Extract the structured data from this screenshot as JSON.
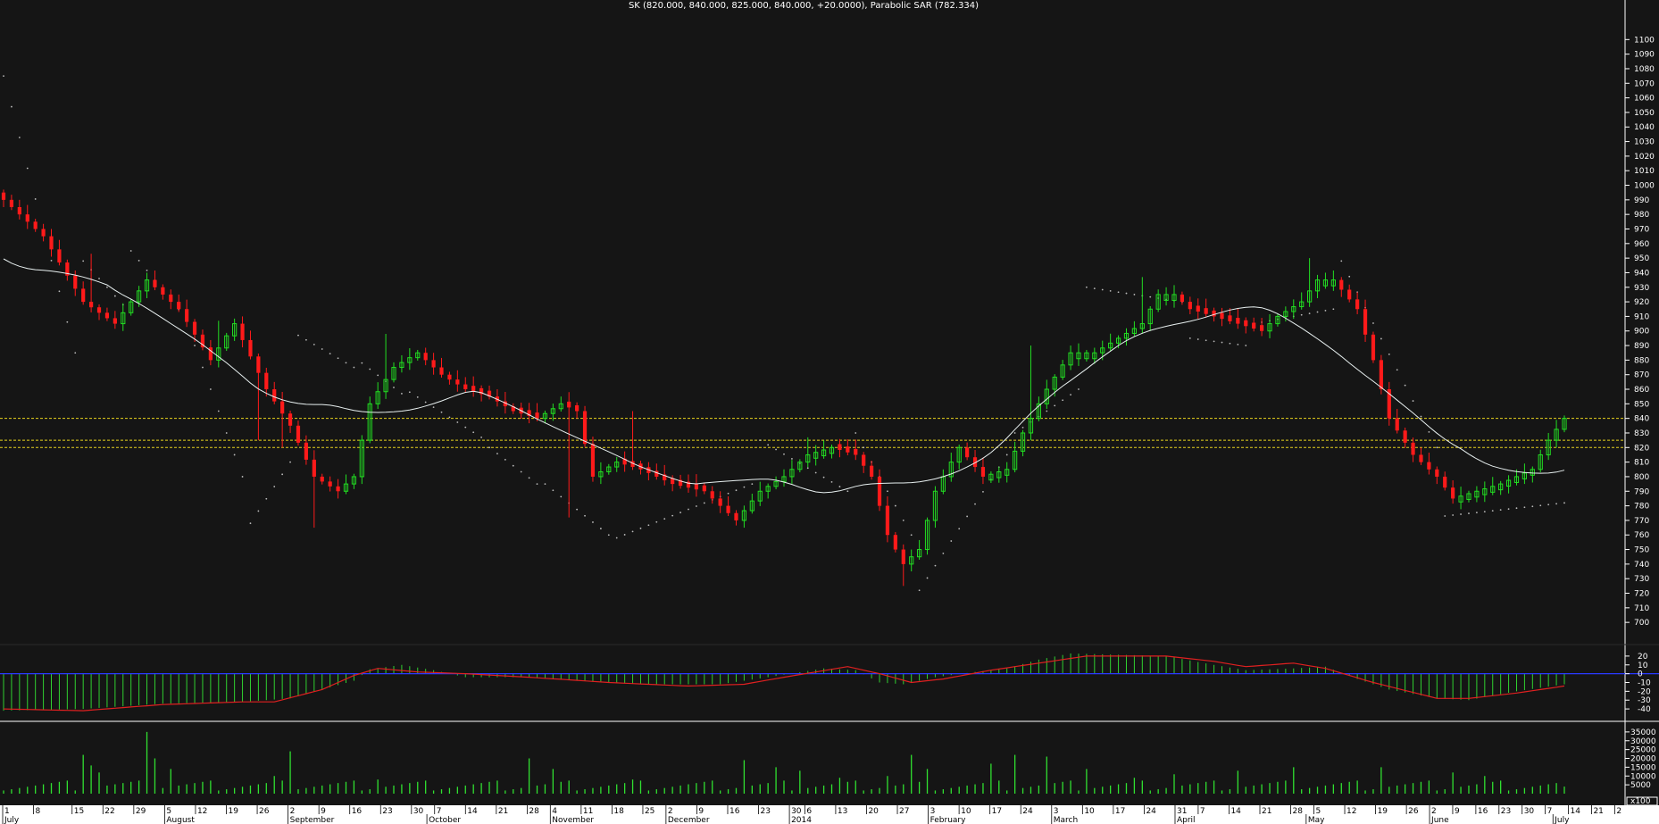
{
  "chart_data": {
    "type": "candlestick",
    "title": "SK (820.000, 840.000, 825.000, 840.000, +20.0000), Parabolic SAR (782.334)",
    "colors": {
      "background": "#151515",
      "up": "#22dd22",
      "down": "#ff1a1a",
      "ma_line": "#e8f0f0",
      "sar_dots": "#bbbbbb",
      "ref_lines": "#e6d21e",
      "macd_hist": "#30d030",
      "macd_signal": "#e02020",
      "macd_zero": "#2a3aff",
      "volume": "#30e030",
      "axis_bar": "#ffffff",
      "grid_text": "#ffffff"
    },
    "price_axis": {
      "ylim": [
        686,
        1110
      ],
      "ticks": [
        700,
        710,
        720,
        730,
        740,
        750,
        760,
        770,
        780,
        790,
        800,
        810,
        820,
        830,
        840,
        850,
        860,
        870,
        880,
        890,
        900,
        910,
        920,
        930,
        940,
        950,
        960,
        970,
        980,
        990,
        1000,
        1010,
        1020,
        1030,
        1040,
        1050,
        1060,
        1070,
        1080,
        1090,
        1100
      ]
    },
    "reference_lines": [
      840,
      825,
      820
    ],
    "price_keypoints": [
      [
        0,
        990
      ],
      [
        5,
        965
      ],
      [
        10,
        920
      ],
      [
        14,
        905
      ],
      [
        18,
        935
      ],
      [
        22,
        915
      ],
      [
        26,
        880
      ],
      [
        29,
        905
      ],
      [
        33,
        860
      ],
      [
        36,
        835
      ],
      [
        39,
        800
      ],
      [
        42,
        790
      ],
      [
        44,
        800
      ],
      [
        46,
        850
      ],
      [
        49,
        875
      ],
      [
        52,
        885
      ],
      [
        55,
        870
      ],
      [
        58,
        860
      ],
      [
        61,
        855
      ],
      [
        64,
        845
      ],
      [
        67,
        840
      ],
      [
        70,
        850
      ],
      [
        72,
        845
      ],
      [
        74,
        800
      ],
      [
        77,
        810
      ],
      [
        80,
        805
      ],
      [
        84,
        795
      ],
      [
        88,
        790
      ],
      [
        92,
        770
      ],
      [
        95,
        790
      ],
      [
        98,
        800
      ],
      [
        101,
        815
      ],
      [
        104,
        820
      ],
      [
        107,
        815
      ],
      [
        109,
        800
      ],
      [
        111,
        760
      ],
      [
        113,
        740
      ],
      [
        115,
        750
      ],
      [
        117,
        790
      ],
      [
        120,
        820
      ],
      [
        123,
        800
      ],
      [
        126,
        805
      ],
      [
        128,
        830
      ],
      [
        131,
        860
      ],
      [
        134,
        885
      ],
      [
        137,
        885
      ],
      [
        140,
        895
      ],
      [
        143,
        905
      ],
      [
        145,
        925
      ],
      [
        147,
        925
      ],
      [
        149,
        915
      ],
      [
        152,
        910
      ],
      [
        155,
        905
      ],
      [
        158,
        900
      ],
      [
        160,
        910
      ],
      [
        163,
        920
      ],
      [
        165,
        935
      ],
      [
        167,
        935
      ],
      [
        170,
        915
      ],
      [
        172,
        880
      ],
      [
        174,
        840
      ],
      [
        177,
        815
      ],
      [
        180,
        800
      ],
      [
        182,
        785
      ],
      [
        185,
        790
      ],
      [
        188,
        795
      ],
      [
        190,
        800
      ],
      [
        192,
        805
      ],
      [
        194,
        825
      ],
      [
        196,
        840
      ]
    ],
    "price_spikes": [
      [
        11,
        953,
        "high"
      ],
      [
        23,
        905,
        "high"
      ],
      [
        27,
        907,
        "high"
      ],
      [
        32,
        825,
        "low"
      ],
      [
        35,
        820,
        "low"
      ],
      [
        39,
        765,
        "low"
      ],
      [
        48,
        898,
        "high"
      ],
      [
        57,
        873,
        "high"
      ],
      [
        71,
        772,
        "low"
      ],
      [
        79,
        845,
        "high"
      ],
      [
        101,
        827,
        "high"
      ],
      [
        113,
        725,
        "low"
      ],
      [
        129,
        890,
        "high"
      ],
      [
        143,
        937,
        "high"
      ],
      [
        164,
        950,
        "high"
      ]
    ],
    "sar_segments": [
      {
        "from": 0,
        "to": 9,
        "start": 1075,
        "end": 885
      },
      {
        "from": 10,
        "to": 15,
        "start": 948,
        "end": 918
      },
      {
        "from": 16,
        "to": 23,
        "start": 955,
        "end": 908
      },
      {
        "from": 24,
        "to": 30,
        "start": 890,
        "end": 800
      },
      {
        "from": 31,
        "to": 36,
        "start": 768,
        "end": 810
      },
      {
        "from": 37,
        "to": 44,
        "start": 897,
        "end": 875
      },
      {
        "from": 45,
        "to": 50,
        "start": 878,
        "end": 857
      },
      {
        "from": 51,
        "to": 60,
        "start": 858,
        "end": 827
      },
      {
        "from": 61,
        "to": 67,
        "start": 820,
        "end": 795
      },
      {
        "from": 68,
        "to": 76,
        "start": 795,
        "end": 760
      },
      {
        "from": 77,
        "to": 94,
        "start": 758,
        "end": 795
      },
      {
        "from": 95,
        "to": 106,
        "start": 825,
        "end": 790
      },
      {
        "from": 107,
        "to": 114,
        "start": 830,
        "end": 760
      },
      {
        "from": 115,
        "to": 126,
        "start": 722,
        "end": 815
      },
      {
        "from": 127,
        "to": 135,
        "start": 830,
        "end": 860
      },
      {
        "from": 136,
        "to": 148,
        "start": 930,
        "end": 920
      },
      {
        "from": 149,
        "to": 156,
        "start": 895,
        "end": 890
      },
      {
        "from": 157,
        "to": 167,
        "start": 905,
        "end": 915
      },
      {
        "from": 168,
        "to": 180,
        "start": 948,
        "end": 820
      },
      {
        "from": 181,
        "to": 196,
        "start": 773,
        "end": 782
      }
    ],
    "macd_axis": {
      "ylim": [
        -48,
        28
      ],
      "ticks": [
        20,
        10,
        0,
        -10,
        -20,
        -30,
        -40
      ]
    },
    "macd_hist_keypoints": [
      [
        0,
        -42
      ],
      [
        10,
        -40
      ],
      [
        20,
        -34
      ],
      [
        30,
        -32
      ],
      [
        36,
        -28
      ],
      [
        40,
        -18
      ],
      [
        44,
        -8
      ],
      [
        46,
        5
      ],
      [
        50,
        10
      ],
      [
        54,
        4
      ],
      [
        58,
        -4
      ],
      [
        65,
        -4
      ],
      [
        70,
        -6
      ],
      [
        75,
        -10
      ],
      [
        80,
        -12
      ],
      [
        90,
        -12
      ],
      [
        96,
        -4
      ],
      [
        103,
        6
      ],
      [
        107,
        4
      ],
      [
        110,
        -10
      ],
      [
        113,
        -12
      ],
      [
        117,
        -4
      ],
      [
        122,
        2
      ],
      [
        126,
        6
      ],
      [
        130,
        16
      ],
      [
        134,
        23
      ],
      [
        138,
        22
      ],
      [
        146,
        20
      ],
      [
        152,
        10
      ],
      [
        156,
        4
      ],
      [
        162,
        6
      ],
      [
        166,
        8
      ],
      [
        170,
        -6
      ],
      [
        174,
        -18
      ],
      [
        180,
        -28
      ],
      [
        184,
        -30
      ],
      [
        190,
        -20
      ],
      [
        196,
        -12
      ]
    ],
    "macd_signal_keypoints": [
      [
        0,
        -40
      ],
      [
        10,
        -42
      ],
      [
        20,
        -35
      ],
      [
        30,
        -32
      ],
      [
        34,
        -32
      ],
      [
        40,
        -18
      ],
      [
        44,
        -2
      ],
      [
        47,
        6
      ],
      [
        52,
        2
      ],
      [
        58,
        0
      ],
      [
        66,
        -4
      ],
      [
        76,
        -10
      ],
      [
        86,
        -14
      ],
      [
        93,
        -12
      ],
      [
        98,
        -4
      ],
      [
        102,
        2
      ],
      [
        106,
        8
      ],
      [
        110,
        0
      ],
      [
        114,
        -10
      ],
      [
        118,
        -6
      ],
      [
        124,
        4
      ],
      [
        130,
        12
      ],
      [
        136,
        20
      ],
      [
        146,
        20
      ],
      [
        152,
        14
      ],
      [
        156,
        8
      ],
      [
        162,
        12
      ],
      [
        166,
        6
      ],
      [
        172,
        -10
      ],
      [
        180,
        -28
      ],
      [
        184,
        -28
      ],
      [
        190,
        -22
      ],
      [
        196,
        -14
      ]
    ],
    "volume_axis": {
      "ylim": [
        0,
        40000
      ],
      "ticks": [
        35000,
        30000,
        25000,
        20000,
        15000,
        10000,
        5000
      ],
      "unit_label": "x100"
    },
    "volume_spikes": [
      [
        10,
        22000
      ],
      [
        11,
        16000
      ],
      [
        12,
        12000
      ],
      [
        18,
        35000
      ],
      [
        19,
        20000
      ],
      [
        21,
        14000
      ],
      [
        34,
        10000
      ],
      [
        36,
        24000
      ],
      [
        47,
        8000
      ],
      [
        66,
        20000
      ],
      [
        69,
        14000
      ],
      [
        79,
        8000
      ],
      [
        93,
        19000
      ],
      [
        97,
        15000
      ],
      [
        100,
        13000
      ],
      [
        105,
        9000
      ],
      [
        111,
        10000
      ],
      [
        114,
        22000
      ],
      [
        116,
        14000
      ],
      [
        124,
        17000
      ],
      [
        127,
        22000
      ],
      [
        131,
        21000
      ],
      [
        136,
        14000
      ],
      [
        142,
        9000
      ],
      [
        147,
        11000
      ],
      [
        155,
        13000
      ],
      [
        162,
        15000
      ],
      [
        173,
        15000
      ],
      [
        182,
        12000
      ],
      [
        186,
        10000
      ],
      [
        196,
        4000
      ]
    ],
    "x_axis": {
      "ticks": [
        {
          "i": 0,
          "label": "1"
        },
        {
          "i": 4,
          "label": "8"
        },
        {
          "i": 9,
          "label": "15"
        },
        {
          "i": 13,
          "label": "22"
        },
        {
          "i": 17,
          "label": "29"
        },
        {
          "i": 21,
          "label": "5"
        },
        {
          "i": 25,
          "label": "12"
        },
        {
          "i": 29,
          "label": "19"
        },
        {
          "i": 33,
          "label": "26"
        },
        {
          "i": 37,
          "label": "2"
        },
        {
          "i": 41,
          "label": "9"
        },
        {
          "i": 45,
          "label": "16"
        },
        {
          "i": 49,
          "label": "23"
        },
        {
          "i": 53,
          "label": "30"
        },
        {
          "i": 56,
          "label": "7"
        },
        {
          "i": 60,
          "label": "14"
        },
        {
          "i": 64,
          "label": "21"
        },
        {
          "i": 68,
          "label": "28"
        },
        {
          "i": 71,
          "label": "4"
        },
        {
          "i": 75,
          "label": "11"
        },
        {
          "i": 79,
          "label": "18"
        },
        {
          "i": 83,
          "label": "25"
        },
        {
          "i": 86,
          "label": "2"
        },
        {
          "i": 90,
          "label": "9"
        },
        {
          "i": 94,
          "label": "16"
        },
        {
          "i": 98,
          "label": "23"
        },
        {
          "i": 102,
          "label": "30"
        },
        {
          "i": 104,
          "label": "6"
        },
        {
          "i": 108,
          "label": "13"
        },
        {
          "i": 112,
          "label": "20"
        },
        {
          "i": 116,
          "label": "27"
        },
        {
          "i": 120,
          "label": "3"
        },
        {
          "i": 124,
          "label": "10"
        },
        {
          "i": 128,
          "label": "17"
        },
        {
          "i": 132,
          "label": "24"
        },
        {
          "i": 136,
          "label": "3"
        },
        {
          "i": 140,
          "label": "10"
        },
        {
          "i": 144,
          "label": "17"
        },
        {
          "i": 148,
          "label": "24"
        },
        {
          "i": 152,
          "label": "31"
        },
        {
          "i": 155,
          "label": "7"
        },
        {
          "i": 159,
          "label": "14"
        },
        {
          "i": 163,
          "label": "21"
        },
        {
          "i": 167,
          "label": "28"
        },
        {
          "i": 170,
          "label": "5"
        },
        {
          "i": 174,
          "label": "12"
        },
        {
          "i": 178,
          "label": "19"
        },
        {
          "i": 182,
          "label": "26"
        },
        {
          "i": 185,
          "label": "2"
        },
        {
          "i": 188,
          "label": "9"
        },
        {
          "i": 191,
          "label": "16"
        },
        {
          "i": 194,
          "label": "23"
        },
        {
          "i": 197,
          "label": "30"
        },
        {
          "i": 200,
          "label": "7"
        },
        {
          "i": 203,
          "label": "14"
        },
        {
          "i": 206,
          "label": "21"
        },
        {
          "i": 209,
          "label": "2"
        }
      ],
      "months": [
        {
          "i": 0,
          "label": "July"
        },
        {
          "i": 21,
          "label": "August"
        },
        {
          "i": 37,
          "label": "September"
        },
        {
          "i": 55,
          "label": "October"
        },
        {
          "i": 71,
          "label": "November"
        },
        {
          "i": 86,
          "label": "December"
        },
        {
          "i": 102,
          "label": "2014"
        },
        {
          "i": 120,
          "label": "February"
        },
        {
          "i": 136,
          "label": "March"
        },
        {
          "i": 152,
          "label": "April"
        },
        {
          "i": 169,
          "label": "May"
        },
        {
          "i": 185,
          "label": "June"
        },
        {
          "i": 201,
          "label": "July"
        }
      ]
    }
  }
}
